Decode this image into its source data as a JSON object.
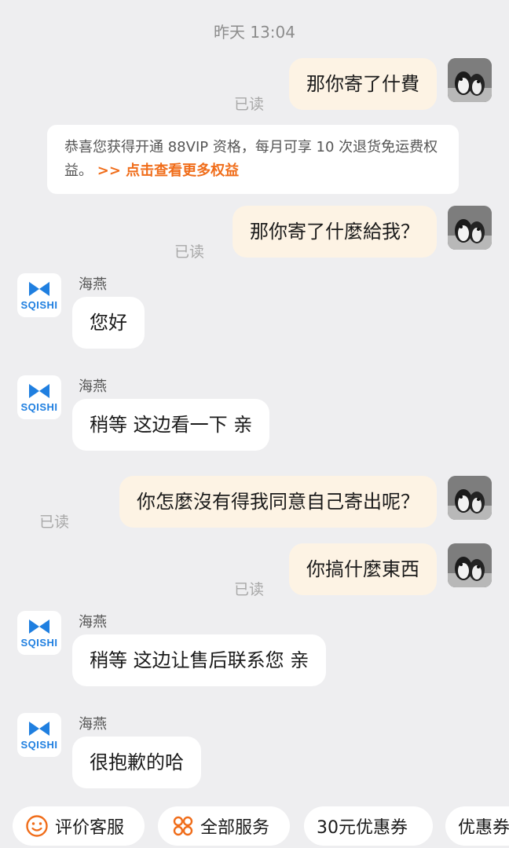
{
  "timestamp": "昨天 13:04",
  "read_label": "已读",
  "shop_name": "海燕",
  "shop_logo_text": "SQISHI",
  "notice": {
    "text": "恭喜您获得开通 88VIP 资格，每月可享 10 次退货免运费权益。",
    "link": ">> 点击查看更多权益"
  },
  "messages": [
    {
      "from": "me",
      "text": "那你寄了什費",
      "read": true
    },
    {
      "from": "me",
      "text": "那你寄了什麼給我？",
      "read": true
    },
    {
      "from": "shop",
      "sender": "海燕",
      "text": "您好"
    },
    {
      "from": "shop",
      "sender": "海燕",
      "text": "稍等 这边看一下 亲"
    },
    {
      "from": "me",
      "text": "你怎麼沒有得我同意自己寄出呢？",
      "read": true
    },
    {
      "from": "me",
      "text": "你搞什麼東西",
      "read": true
    },
    {
      "from": "shop",
      "sender": "海燕",
      "text": "稍等 这边让售后联系您 亲"
    },
    {
      "from": "shop",
      "sender": "海燕",
      "text": "很抱歉的哈"
    }
  ],
  "quick_actions": [
    {
      "label": "评价客服",
      "icon": "smile-icon"
    },
    {
      "label": "全部服务",
      "icon": "grid-icon"
    },
    {
      "label": "30元优惠券",
      "icon": ""
    },
    {
      "label": "优惠券",
      "icon": ""
    }
  ],
  "colors": {
    "background": "#eeeef0",
    "my_bubble": "#fdf3e4",
    "shop_bubble": "#ffffff",
    "accent": "#f06d1a",
    "shop_logo": "#1f7fe0"
  }
}
